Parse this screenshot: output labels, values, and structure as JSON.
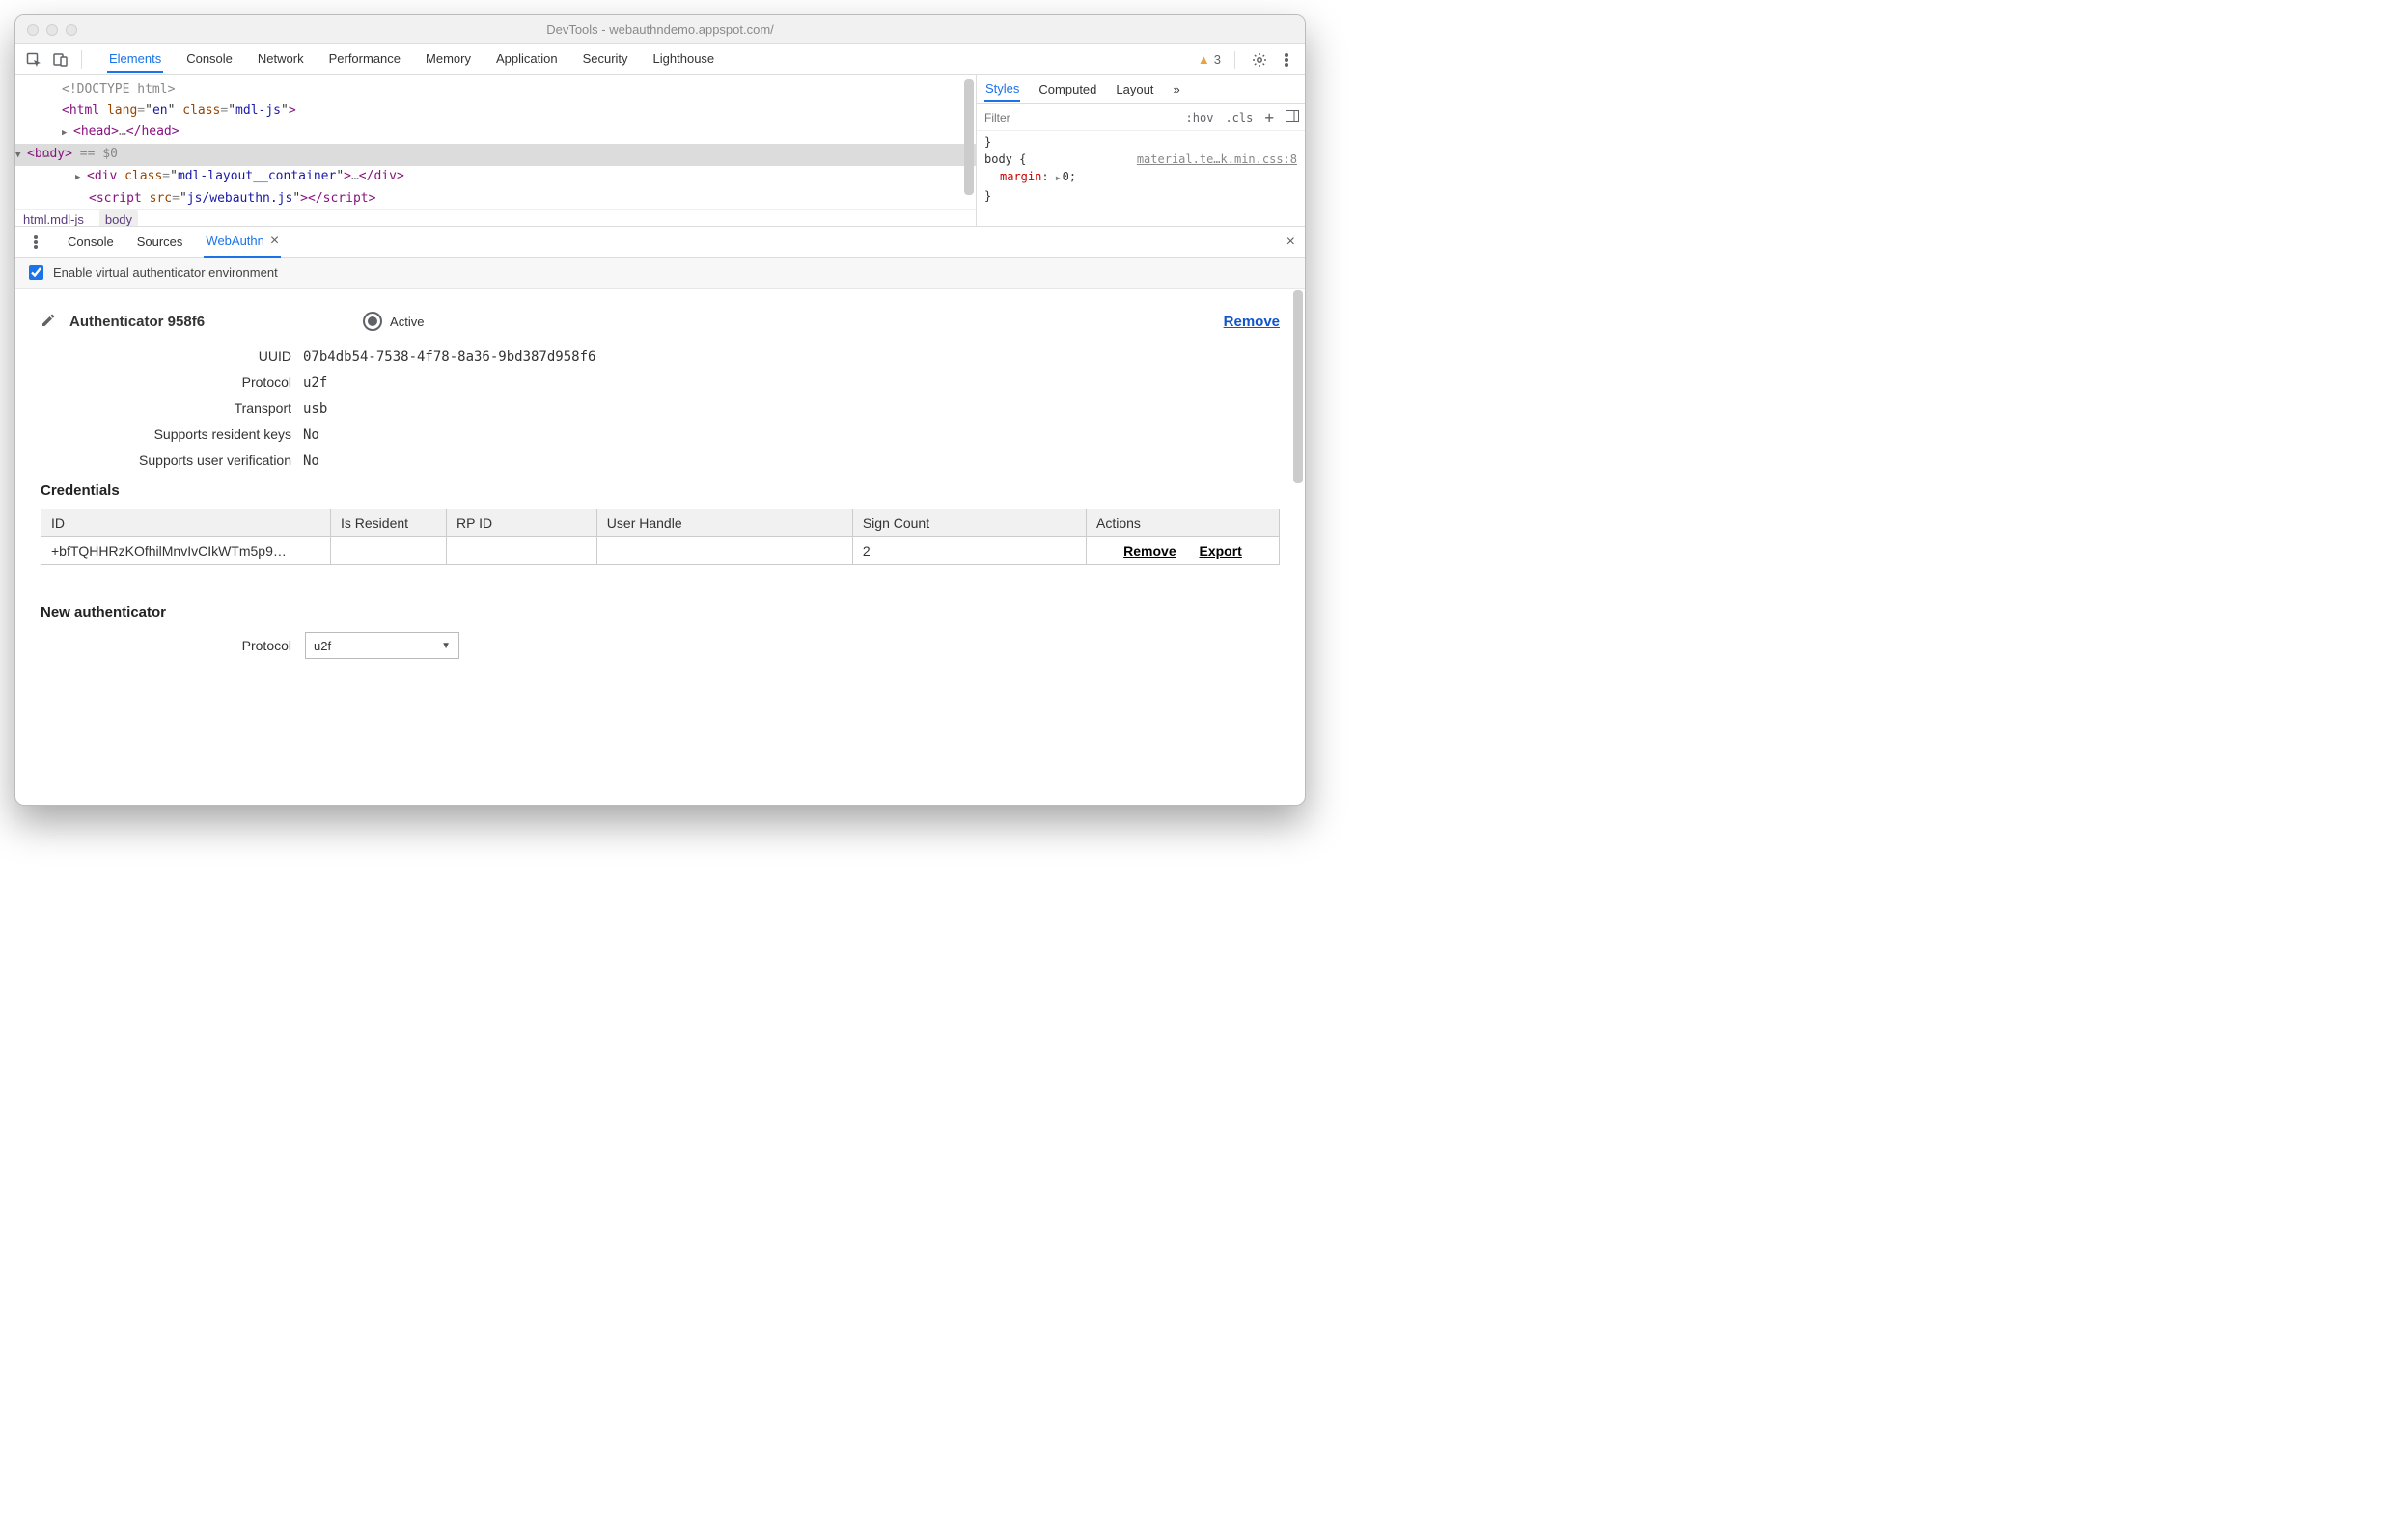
{
  "window": {
    "title": "DevTools - webauthndemo.appspot.com/"
  },
  "toolbar": {
    "tabs": [
      "Elements",
      "Console",
      "Network",
      "Performance",
      "Memory",
      "Application",
      "Security",
      "Lighthouse"
    ],
    "active": "Elements",
    "warning_count": "3"
  },
  "elements": {
    "source_lines": {
      "l0": "<!DOCTYPE html>",
      "html_tag": "html",
      "html_lang_attr": "lang",
      "html_lang_val": "en",
      "html_class_attr": "class",
      "html_class_val": "mdl-js",
      "head_tag": "head",
      "head_ellipsis": "…",
      "body_tag": "body",
      "body_eq": " == $0",
      "div_tag": "div",
      "div_class_attr": "class",
      "div_class_val": "mdl-layout__container",
      "div_ellipsis": "…",
      "script_tag": "script",
      "script_src_attr": "src",
      "script_src_val": "js/webauthn.js",
      "dots": "…"
    },
    "breadcrumbs": {
      "a": "html.mdl-js",
      "b": "body"
    }
  },
  "styles": {
    "tabs": {
      "a": "Styles",
      "b": "Computed",
      "c": "Layout",
      "more": "»"
    },
    "filter_placeholder": "Filter",
    "hov": ":hov",
    "cls": ".cls",
    "brace_top": "}",
    "body_selector": "body {",
    "body_source": "material.te…k.min.css:8",
    "prop_name": "margin",
    "prop_val": "0;",
    "brace_bot": "}"
  },
  "drawer": {
    "tabs": {
      "a": "Console",
      "b": "Sources",
      "c": "WebAuthn"
    },
    "active": "WebAuthn",
    "enable_label": "Enable virtual authenticator environment",
    "enable_checked": true
  },
  "authenticator": {
    "title": "Authenticator 958f6",
    "active_label": "Active",
    "remove_label": "Remove",
    "kv": {
      "uuid_label": "UUID",
      "uuid_val": "07b4db54-7538-4f78-8a36-9bd387d958f6",
      "protocol_label": "Protocol",
      "protocol_val": "u2f",
      "transport_label": "Transport",
      "transport_val": "usb",
      "resident_label": "Supports resident keys",
      "resident_val": "No",
      "userver_label": "Supports user verification",
      "userver_val": "No"
    }
  },
  "credentials": {
    "heading": "Credentials",
    "headers": {
      "id": "ID",
      "is_resident": "Is Resident",
      "rp_id": "RP ID",
      "user_handle": "User Handle",
      "sign_count": "Sign Count",
      "actions": "Actions"
    },
    "row": {
      "id": "+bfTQHHRzKOfhilMnvIvCIkWTm5p9…",
      "is_resident": "",
      "rp_id": "",
      "user_handle": "",
      "sign_count": "2",
      "remove": "Remove",
      "export": "Export"
    }
  },
  "new_auth": {
    "heading": "New authenticator",
    "protocol_label": "Protocol",
    "protocol_value": "u2f"
  }
}
